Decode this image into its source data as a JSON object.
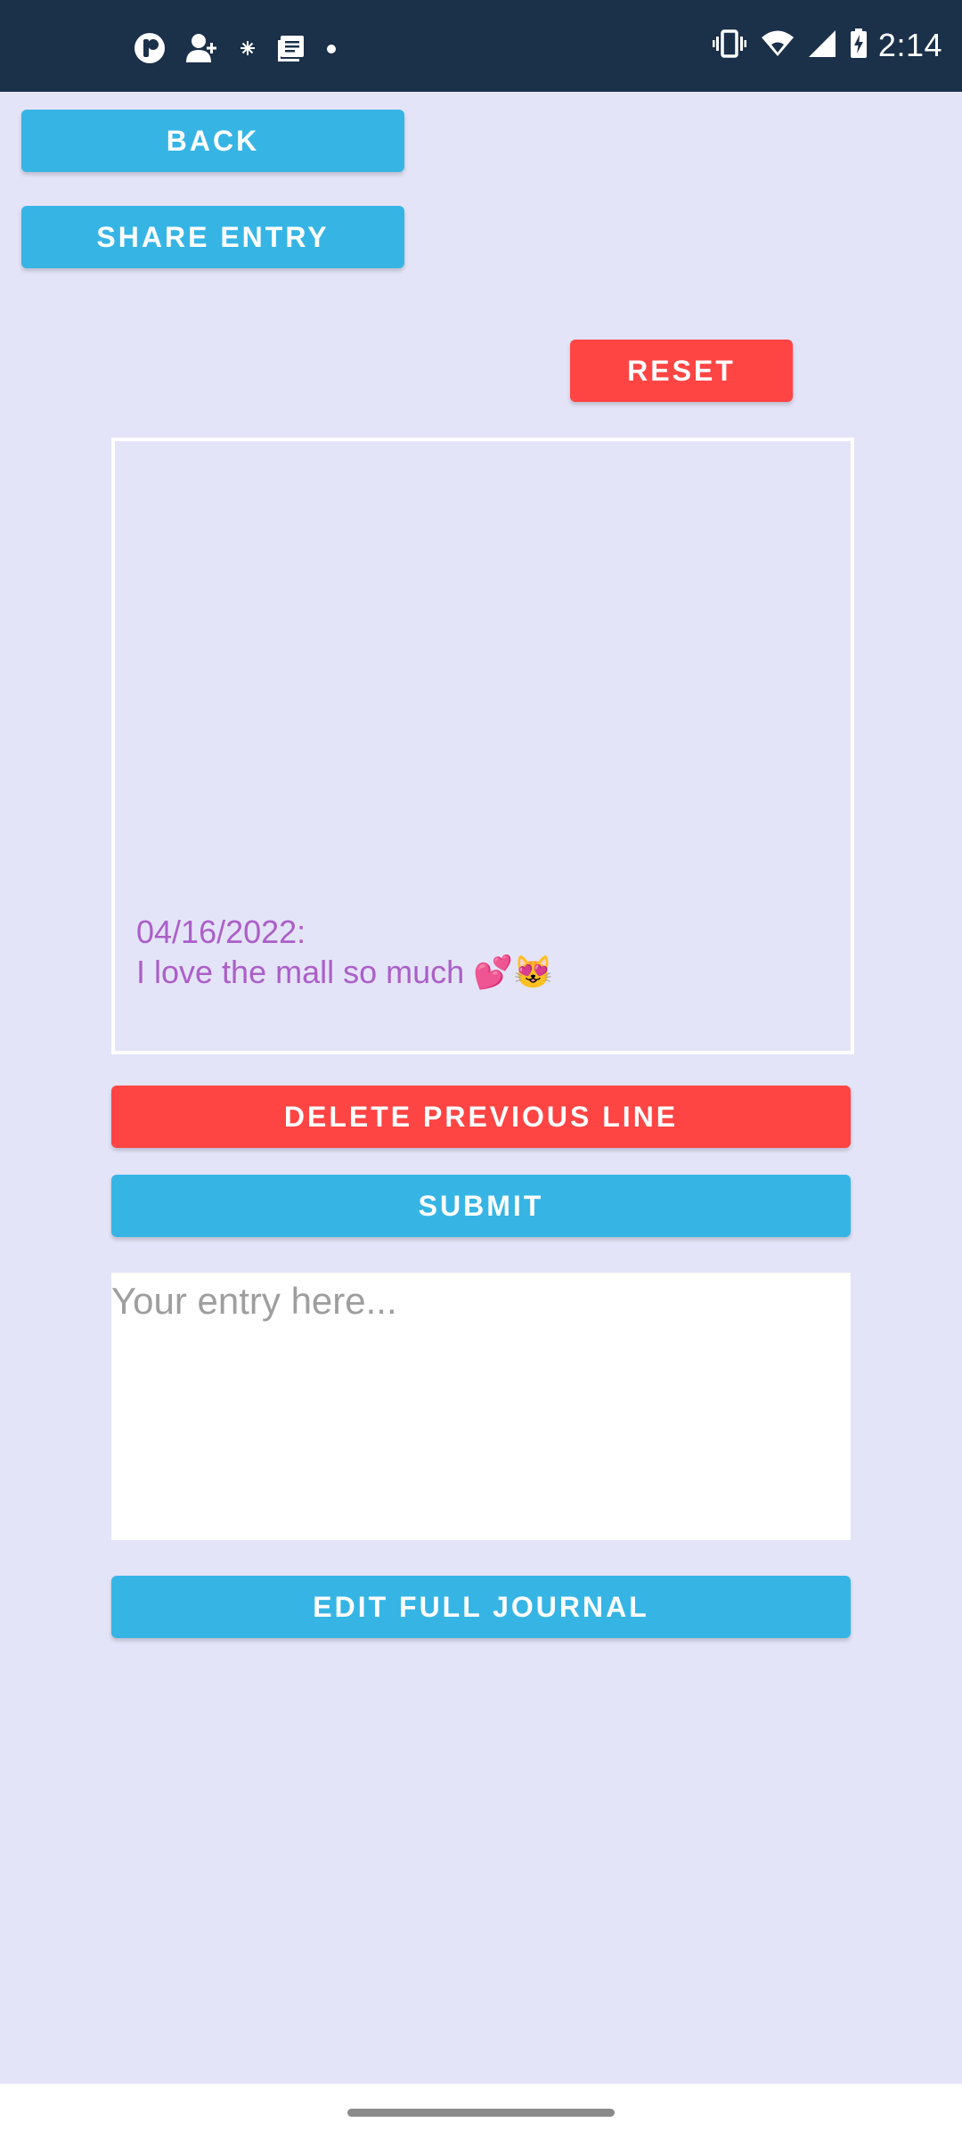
{
  "status_bar": {
    "time": "2:14",
    "left_icons": [
      "app-icon",
      "add-person-icon",
      "sparkle-icon",
      "notes-icon",
      "dot-icon"
    ],
    "right_icons": [
      "vibrate-icon",
      "wifi-icon",
      "signal-icon",
      "battery-charging-icon"
    ]
  },
  "toolbar": {
    "back_label": "BACK",
    "share_label": "SHARE ENTRY",
    "reset_label": "RESET"
  },
  "journal": {
    "date_line": "04/16/2022:",
    "entry_line": "I love the mall so much 💕😻"
  },
  "actions": {
    "delete_label": "DELETE PREVIOUS LINE",
    "submit_label": "SUBMIT",
    "edit_full_label": "EDIT FULL JOURNAL"
  },
  "entry": {
    "value": "",
    "placeholder": "Your entry here..."
  },
  "colors": {
    "background": "#e4e4f8",
    "status_bar": "#1b3049",
    "primary_button": "#36b5e5",
    "danger_button": "#ff4444",
    "journal_text": "#ab5fc8"
  }
}
